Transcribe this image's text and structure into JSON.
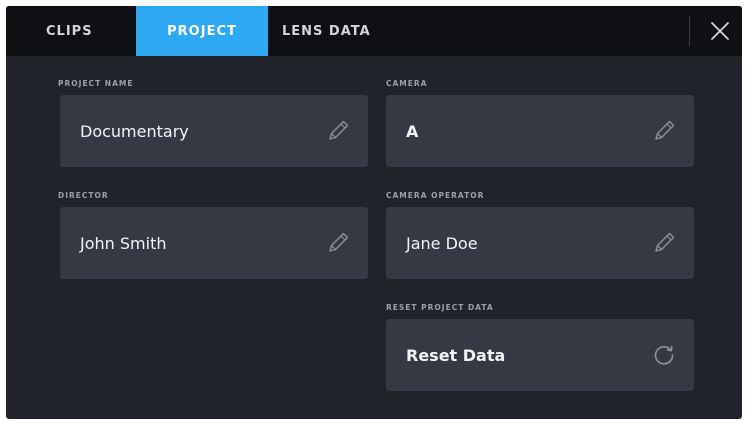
{
  "tabs": [
    {
      "label": "CLIPS",
      "active": false
    },
    {
      "label": "PROJECT",
      "active": true
    },
    {
      "label": "LENS DATA",
      "active": false
    }
  ],
  "close_icon": "close-icon",
  "fields": {
    "project_name": {
      "label": "PROJECT NAME",
      "value": "Documentary",
      "icon": "pencil-icon"
    },
    "camera": {
      "label": "CAMERA",
      "value": "A",
      "icon": "pencil-icon"
    },
    "director": {
      "label": "DIRECTOR",
      "value": "John Smith",
      "icon": "pencil-icon"
    },
    "camera_operator": {
      "label": "CAMERA OPERATOR",
      "value": "Jane Doe",
      "icon": "pencil-icon"
    },
    "reset": {
      "label": "RESET PROJECT DATA",
      "value": "Reset Data",
      "icon": "refresh-icon"
    }
  },
  "colors": {
    "accent": "#2ea8f3",
    "background": "#20232a",
    "tabbar": "#0f1013",
    "field": "#353944"
  }
}
